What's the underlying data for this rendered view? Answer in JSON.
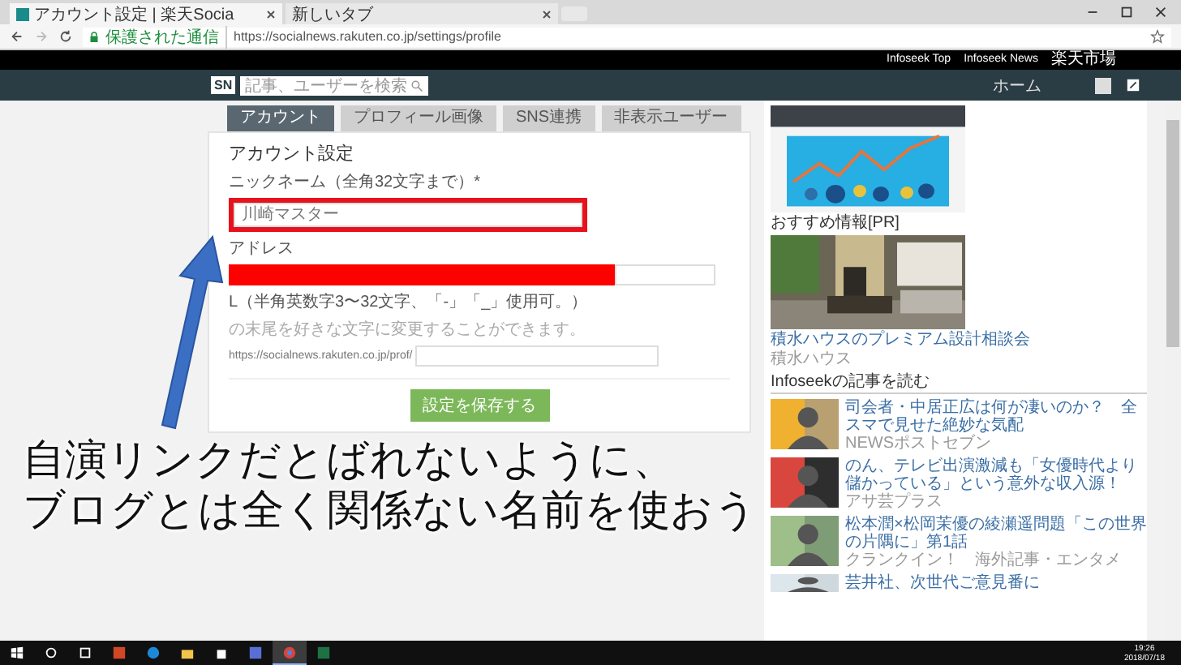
{
  "browser": {
    "tabs": [
      {
        "title": "アカウント設定 | 楽天Socia",
        "selected": true
      },
      {
        "title": "新しいタブ",
        "selected": false
      }
    ],
    "security_label": "保護された通信",
    "url": "https://socialnews.rakuten.co.jp/settings/profile"
  },
  "top_links": [
    "Infoseek Top",
    "Infoseek News",
    "楽天市場"
  ],
  "header": {
    "logo": "SN",
    "search": {
      "placeholder": "記事、ユーザーを検索"
    },
    "nav": "ホーム"
  },
  "settings_tabs": [
    {
      "label": "アカウント",
      "selected": true
    },
    {
      "label": "プロフィール画像",
      "selected": false
    },
    {
      "label": "SNS連携",
      "selected": false
    },
    {
      "label": "非表示ユーザー",
      "selected": false
    }
  ],
  "form": {
    "title": "アカウント設定",
    "fields": [
      {
        "kind": "text",
        "label": "ニックネーム（全角32文字まで）*",
        "value": "川崎マスター",
        "highlighted": true
      },
      {
        "kind": "redacted",
        "label": "アドレス"
      },
      {
        "kind": "url",
        "label": "L（半角英数字3〜32文字、「-」「_」使用可。）",
        "hint": "の末尾を好きな文字に変更することができます。",
        "prefix": "https://socialnews.rakuten.co.jp/prof/"
      }
    ],
    "save_button": "設定を保存する"
  },
  "sidebar": {
    "recommend_heading": "おすすめ情報[PR]",
    "promo": {
      "title": "積水ハウスのプレミアム設計相談会",
      "source": "積水ハウス"
    },
    "articles_heading": "Infoseekの記事を読む",
    "articles": [
      {
        "title": "司会者・中居正広は何が凄いのか？　全スマで見せた絶妙な気配",
        "source": "NEWSポストセブン"
      },
      {
        "title": "のん、テレビ出演激減も「女優時代より儲かっている」という意外な収入源！",
        "source": "アサ芸プラス"
      },
      {
        "title": "松本潤×松岡茉優の綾瀬遥問題「この世界の片隅に」第1話",
        "source": "クランクイン！　海外記事・エンタメ"
      },
      {
        "title": "芸井社、次世代ご意見番に"
      }
    ]
  },
  "annotation": {
    "lines": [
      "自演リンクだとばれないように、",
      "ブログとは全く関係ない名前を使おう"
    ]
  },
  "taskbar": {
    "apps": [
      {
        "kind": "windows",
        "selected": false
      },
      {
        "kind": "search",
        "selected": false
      },
      {
        "kind": "taskview",
        "selected": false
      },
      {
        "kind": "slides",
        "selected": false
      },
      {
        "kind": "edge",
        "selected": false
      },
      {
        "kind": "folder",
        "selected": false
      },
      {
        "kind": "store",
        "selected": false
      },
      {
        "kind": "app",
        "selected": false
      },
      {
        "kind": "chrome",
        "selected": true
      },
      {
        "kind": "sheet",
        "selected": false
      }
    ],
    "time": "19:26",
    "date": "2018/07/18"
  }
}
